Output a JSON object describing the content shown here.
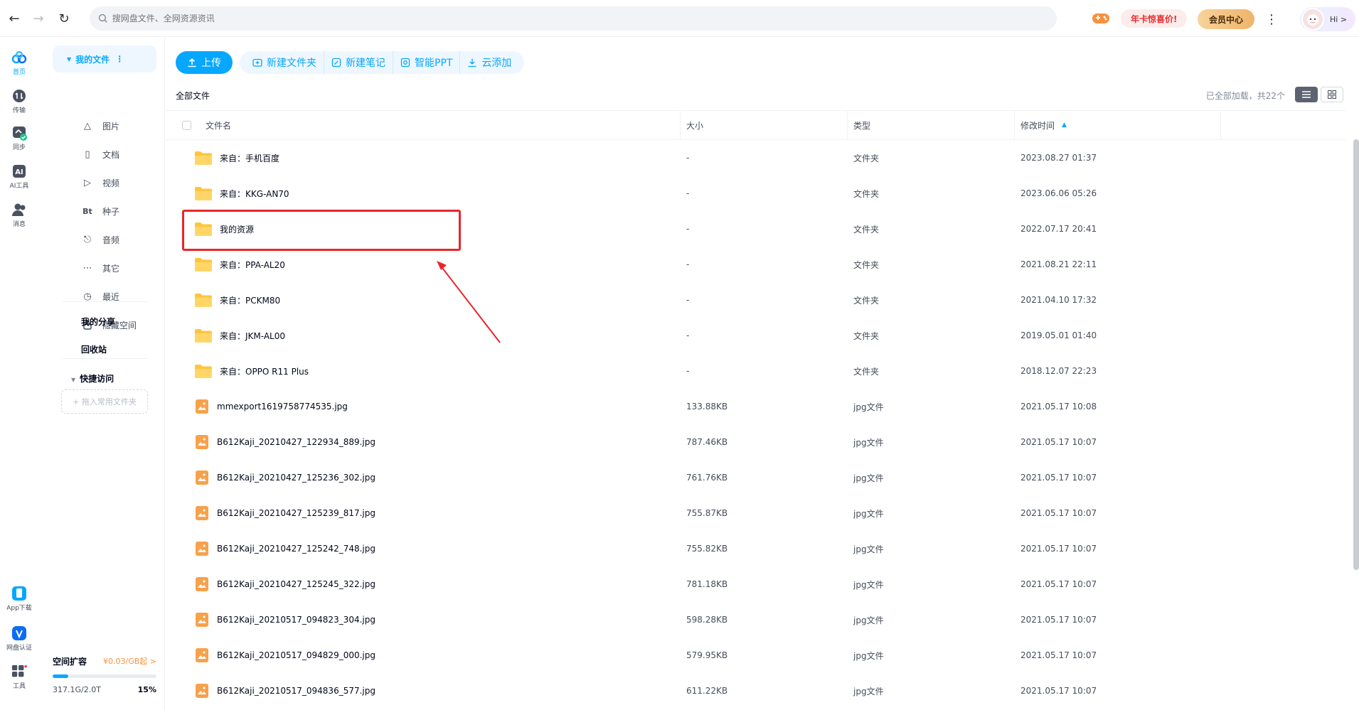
{
  "topbar": {
    "search_placeholder": "搜网盘文件、全网资源资讯",
    "promo_label": "年卡惊喜价!",
    "vip_label": "会员中心",
    "greeting": "Hi >"
  },
  "rail": {
    "items": [
      {
        "label": "首页",
        "icon": "home-cloud-icon",
        "active": true
      },
      {
        "label": "传输",
        "icon": "transfer-icon"
      },
      {
        "label": "同步",
        "icon": "sync-icon"
      },
      {
        "label": "AI工具",
        "icon": "ai-icon"
      },
      {
        "label": "消息",
        "icon": "message-icon"
      }
    ],
    "bottom": [
      {
        "label": "App下载",
        "icon": "phone-icon"
      },
      {
        "label": "网盘认证",
        "icon": "verify-icon"
      },
      {
        "label": "工具",
        "icon": "tools-grid-icon"
      }
    ]
  },
  "catpanel": {
    "my_files": "我的文件",
    "categories": [
      {
        "label": "图片",
        "icon": "image-icon"
      },
      {
        "label": "文档",
        "icon": "document-icon"
      },
      {
        "label": "视频",
        "icon": "video-icon"
      },
      {
        "label": "种子",
        "icon": "torrent-icon"
      },
      {
        "label": "音频",
        "icon": "audio-icon"
      },
      {
        "label": "其它",
        "icon": "other-icon"
      },
      {
        "label": "最近",
        "icon": "recent-icon"
      },
      {
        "label": "隐藏空间",
        "icon": "lock-icon"
      }
    ],
    "my_share": "我的分享",
    "recycle": "回收站",
    "quick_access": "快捷访问",
    "drag_hint": "+ 拖入常用文件夹",
    "storage": {
      "label": "空间扩容",
      "price": "¥0.03/GB起 >",
      "used": "317.1G/2.0T",
      "percent_text": "15%",
      "percent": 0.15
    }
  },
  "toolbar": {
    "upload": "上传",
    "new_folder": "新建文件夹",
    "new_note": "新建笔记",
    "smart_ppt": "智能PPT",
    "cloud_add": "云添加"
  },
  "breadcrumb": "全部文件",
  "loaded_text": "已全部加载，共22个",
  "columns": {
    "name": "文件名",
    "size": "大小",
    "type": "类型",
    "modified": "修改时间"
  },
  "files": [
    {
      "name": "来自：手机百度",
      "size": "-",
      "type": "文件夹",
      "time": "2023.08.27 01:37",
      "kind": "folder"
    },
    {
      "name": "来自：KKG-AN70",
      "size": "-",
      "type": "文件夹",
      "time": "2023.06.06 05:26",
      "kind": "folder"
    },
    {
      "name": "我的资源",
      "size": "-",
      "type": "文件夹",
      "time": "2022.07.17 20:41",
      "kind": "folder"
    },
    {
      "name": "来自：PPA-AL20",
      "size": "-",
      "type": "文件夹",
      "time": "2021.08.21 22:11",
      "kind": "folder"
    },
    {
      "name": "来自：PCKM80",
      "size": "-",
      "type": "文件夹",
      "time": "2021.04.10 17:32",
      "kind": "folder"
    },
    {
      "name": "来自：JKM-AL00",
      "size": "-",
      "type": "文件夹",
      "time": "2019.05.01 01:40",
      "kind": "folder"
    },
    {
      "name": "来自：OPPO R11 Plus",
      "size": "-",
      "type": "文件夹",
      "time": "2018.12.07 22:23",
      "kind": "folder"
    },
    {
      "name": "mmexport1619758774535.jpg",
      "size": "133.88KB",
      "type": "jpg文件",
      "time": "2021.05.17 10:08",
      "kind": "image"
    },
    {
      "name": "B612Kaji_20210427_122934_889.jpg",
      "size": "787.46KB",
      "type": "jpg文件",
      "time": "2021.05.17 10:07",
      "kind": "image"
    },
    {
      "name": "B612Kaji_20210427_125236_302.jpg",
      "size": "761.76KB",
      "type": "jpg文件",
      "time": "2021.05.17 10:07",
      "kind": "image"
    },
    {
      "name": "B612Kaji_20210427_125239_817.jpg",
      "size": "755.87KB",
      "type": "jpg文件",
      "time": "2021.05.17 10:07",
      "kind": "image"
    },
    {
      "name": "B612Kaji_20210427_125242_748.jpg",
      "size": "755.82KB",
      "type": "jpg文件",
      "time": "2021.05.17 10:07",
      "kind": "image"
    },
    {
      "name": "B612Kaji_20210427_125245_322.jpg",
      "size": "781.18KB",
      "type": "jpg文件",
      "time": "2021.05.17 10:07",
      "kind": "image"
    },
    {
      "name": "B612Kaji_20210517_094823_304.jpg",
      "size": "598.28KB",
      "type": "jpg文件",
      "time": "2021.05.17 10:07",
      "kind": "image"
    },
    {
      "name": "B612Kaji_20210517_094829_000.jpg",
      "size": "579.95KB",
      "type": "jpg文件",
      "time": "2021.05.17 10:07",
      "kind": "image"
    },
    {
      "name": "B612Kaji_20210517_094836_577.jpg",
      "size": "611.22KB",
      "type": "jpg文件",
      "time": "2021.05.17 10:07",
      "kind": "image"
    }
  ],
  "colors": {
    "accent": "#06a7ff",
    "folder": "#ffc53d",
    "image_file": "#f7a14b",
    "annotation": "#e8262b"
  }
}
